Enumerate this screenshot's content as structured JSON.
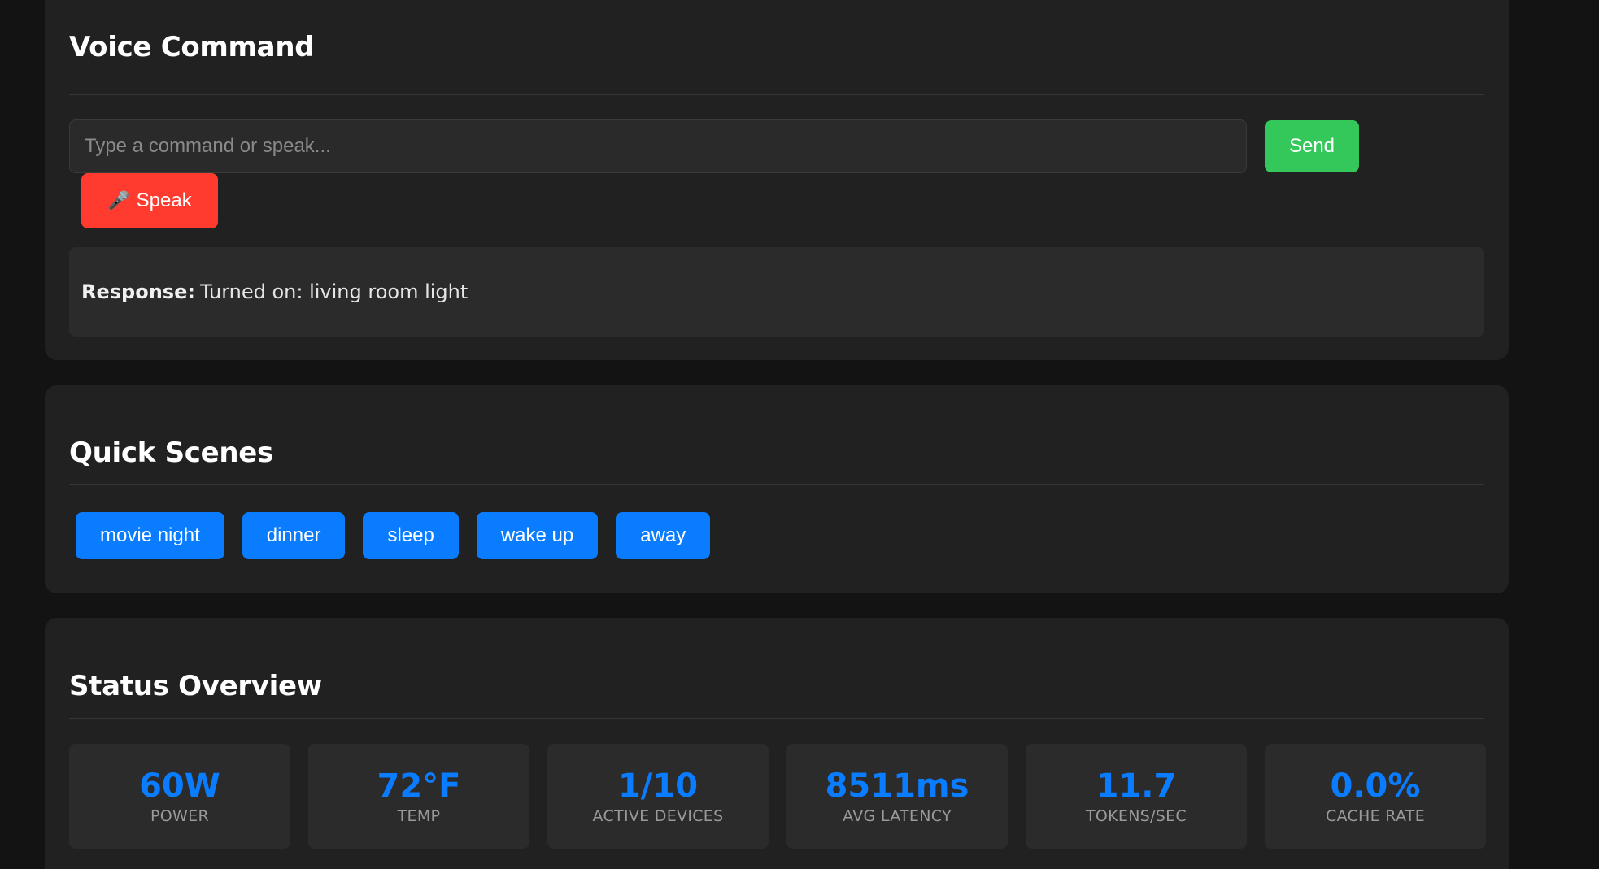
{
  "voice_command": {
    "title": "Voice Command",
    "input": {
      "value": "",
      "placeholder": "Type a command or speak..."
    },
    "send_label": "Send",
    "speak": {
      "icon": "🎤",
      "label": "Speak"
    },
    "response": {
      "label": "Response:",
      "text": "Turned on: living room light"
    }
  },
  "quick_scenes": {
    "title": "Quick Scenes",
    "scenes": [
      "movie night",
      "dinner",
      "sleep",
      "wake up",
      "away"
    ]
  },
  "status_overview": {
    "title": "Status Overview",
    "stats": [
      {
        "value": "60W",
        "label": "POWER"
      },
      {
        "value": "72°F",
        "label": "TEMP"
      },
      {
        "value": "1/10",
        "label": "ACTIVE DEVICES"
      },
      {
        "value": "8511ms",
        "label": "AVG LATENCY"
      },
      {
        "value": "11.7",
        "label": "TOKENS/SEC"
      },
      {
        "value": "0.0%",
        "label": "CACHE RATE"
      }
    ]
  },
  "colors": {
    "background": "#131313",
    "card": "#212121",
    "accent_blue": "#0a7cff",
    "send_green": "#34c759",
    "speak_red": "#ff3b30"
  }
}
